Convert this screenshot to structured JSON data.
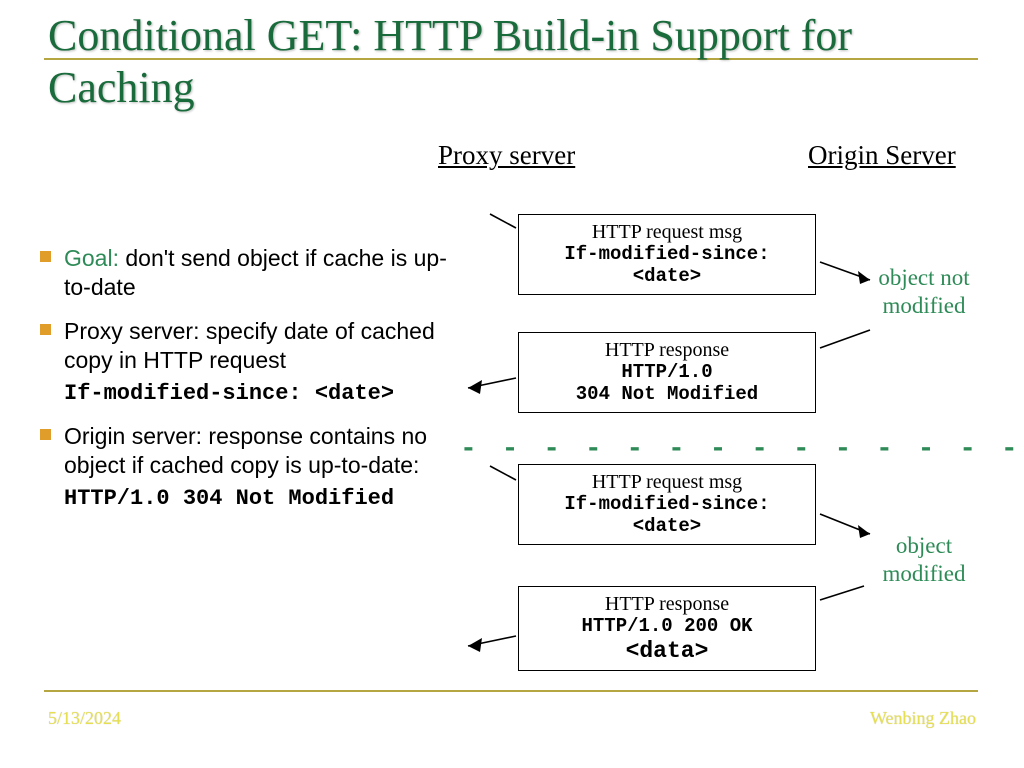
{
  "title": "Conditional GET: HTTP Build-in Support for Caching",
  "footer": {
    "date": "5/13/2024",
    "author": "Wenbing Zhao"
  },
  "labels": {
    "proxy": "Proxy server",
    "origin": "Origin Server"
  },
  "bullets": {
    "b1_goal": "Goal:",
    "b1_rest": " don't send object if cache is up-to-date",
    "b2": "Proxy server: specify date of cached copy in HTTP request",
    "b2_code": "If-modified-since: <date>",
    "b3": "Origin server: response contains no object if cached copy is up-to-date:",
    "b3_code": "HTTP/1.0 304 Not Modified"
  },
  "boxes": {
    "req_title": "HTTP request msg",
    "req_l1": "If-modified-since:",
    "req_l2": "<date>",
    "resp304_title": "HTTP response",
    "resp304_l1": "HTTP/1.0",
    "resp304_l2": "304 Not Modified",
    "resp200_title": "HTTP response",
    "resp200_l1": "HTTP/1.0 200 OK",
    "resp200_l2": "<data>"
  },
  "annot": {
    "not_mod": "object not modified",
    "mod": "object modified"
  },
  "dash": "- - - - - - - - - - - - - - - - - - - -"
}
